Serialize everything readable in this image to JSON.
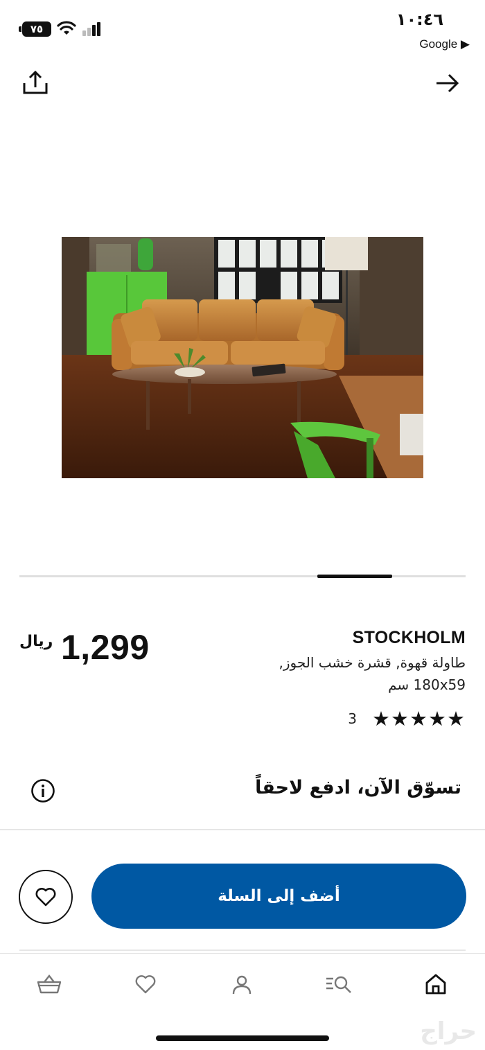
{
  "status_bar": {
    "time": "١٠:٤٦",
    "battery": "٧٥",
    "back_app": "Google ▶"
  },
  "product": {
    "name": "STOCKHOLM",
    "description": "طاولة قهوة, قشرة خشب الجوز, 180x59 سم",
    "price": "1,299",
    "currency": "ريال",
    "rating_stars": "★★★★★",
    "rating_value": 5,
    "review_count": "3"
  },
  "gallery": {
    "active_index": 4,
    "progress_fraction": 0.17
  },
  "paylater": {
    "label": "تسوّق الآن، ادفع لاحقاً"
  },
  "actions": {
    "add_to_cart": "أضف إلى السلة"
  },
  "tabbar": {
    "items": [
      "basket-icon",
      "heart-icon",
      "profile-icon",
      "search-icon",
      "home-icon"
    ],
    "active": "home"
  },
  "watermark": "حراج",
  "colors": {
    "accent": "#0058a3",
    "text": "#111111",
    "sofa_leather": "#c98a3d",
    "green_accent": "#58c73a"
  }
}
